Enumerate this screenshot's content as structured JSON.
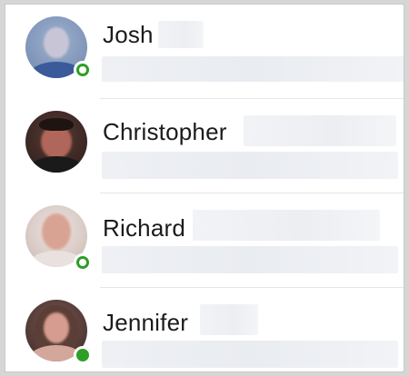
{
  "contacts": [
    {
      "name": "Josh",
      "presence": "available"
    },
    {
      "name": "Christopher",
      "presence": "none"
    },
    {
      "name": "Richard",
      "presence": "available-ring"
    },
    {
      "name": "Jennifer",
      "presence": "available"
    }
  ],
  "colors": {
    "presence_green": "#2f9e27",
    "separator": "#e6e6e6"
  }
}
